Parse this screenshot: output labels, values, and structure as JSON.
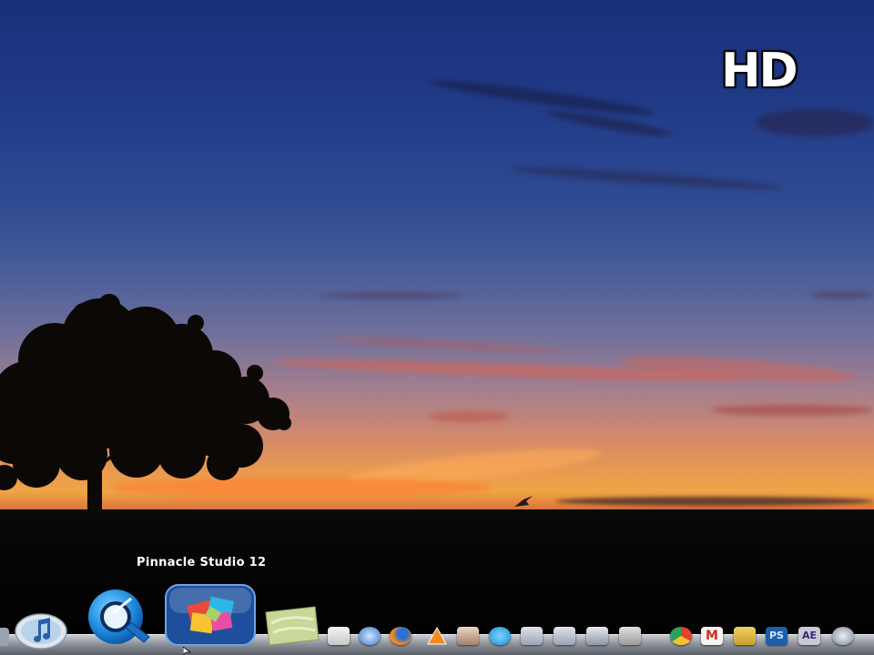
{
  "overlay": {
    "badge": "HD"
  },
  "dock": {
    "hovered_label": "Pinnacle Studio 12",
    "large_items": [
      {
        "name": "itunes-icon"
      },
      {
        "name": "quicktime-icon"
      },
      {
        "name": "pinnacle-studio-icon"
      },
      {
        "name": "notes-icon"
      }
    ],
    "small_items": [
      "calendar-icon",
      "safari-icon",
      "firefox-icon",
      "vlc-icon",
      "mail-icon",
      "skype-icon",
      "folder-icon",
      "folder-icon-2",
      "finder-icon",
      "tools-icon",
      "chrome-icon",
      "gmail-icon",
      "stack-icon",
      "photoshop-icon",
      "after-effects-icon",
      "system-icon"
    ],
    "ps_label": "PS",
    "ae_label": "AE",
    "gmail_label": "M"
  },
  "colors": {
    "dock_shelf": "#8c9098",
    "sky_top": "#1a2f7a",
    "horizon": "#f0a445"
  }
}
